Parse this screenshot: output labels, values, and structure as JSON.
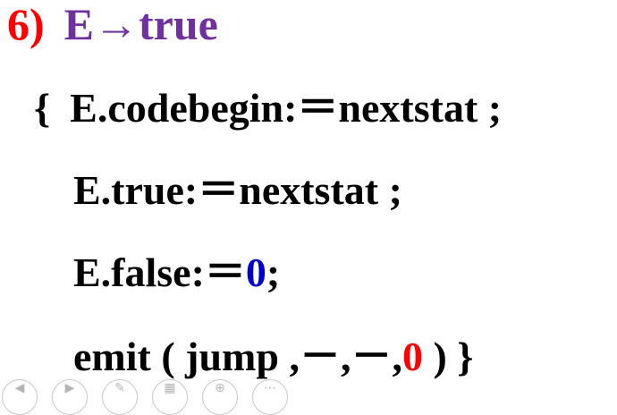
{
  "rule": {
    "number": "6)",
    "production": "E→true"
  },
  "lines": {
    "line1": {
      "open_brace": "{",
      "code": "E.codebegin:＝nextstat ;"
    },
    "line2": {
      "code": "E.true:＝nextstat ;"
    },
    "line3": {
      "prefix": "E.false:＝",
      "value": "0",
      "suffix": ";"
    },
    "line4": {
      "prefix": "emit ( jump ,－,－,",
      "value": "0",
      "suffix": " ) }"
    }
  },
  "colors": {
    "rule_number": "#ff0000",
    "production": "#7030a0",
    "highlight_blue": "#0000cc",
    "highlight_red": "#ff0000",
    "text": "#000000"
  },
  "toolbar": {
    "icons": [
      "prev-icon",
      "next-icon",
      "pen-icon",
      "slides-icon",
      "zoom-icon",
      "more-icon"
    ]
  }
}
